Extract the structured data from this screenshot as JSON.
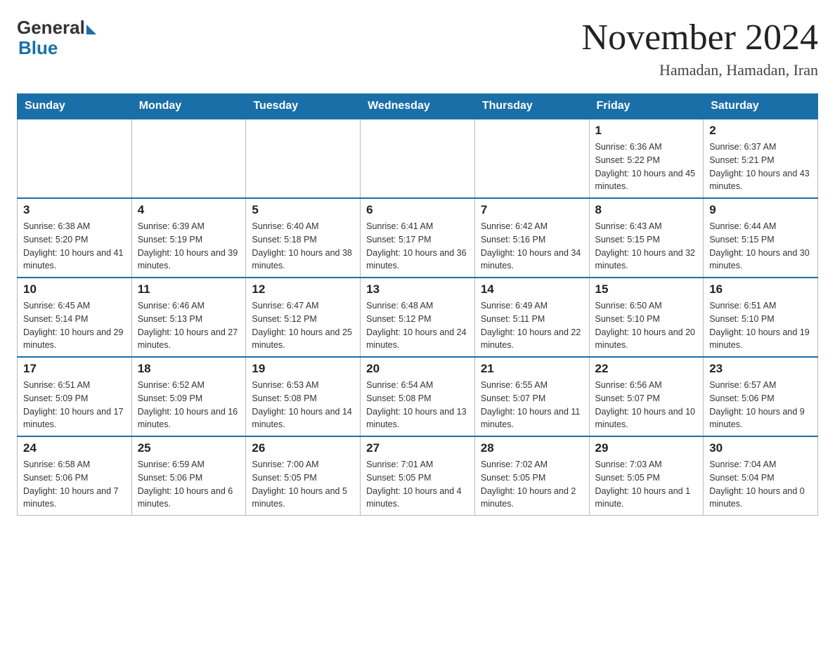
{
  "header": {
    "logo_general": "General",
    "logo_blue": "Blue",
    "month_title": "November 2024",
    "location": "Hamadan, Hamadan, Iran"
  },
  "weekdays": [
    "Sunday",
    "Monday",
    "Tuesday",
    "Wednesday",
    "Thursday",
    "Friday",
    "Saturday"
  ],
  "weeks": [
    [
      {
        "day": "",
        "info": ""
      },
      {
        "day": "",
        "info": ""
      },
      {
        "day": "",
        "info": ""
      },
      {
        "day": "",
        "info": ""
      },
      {
        "day": "",
        "info": ""
      },
      {
        "day": "1",
        "info": "Sunrise: 6:36 AM\nSunset: 5:22 PM\nDaylight: 10 hours and 45 minutes."
      },
      {
        "day": "2",
        "info": "Sunrise: 6:37 AM\nSunset: 5:21 PM\nDaylight: 10 hours and 43 minutes."
      }
    ],
    [
      {
        "day": "3",
        "info": "Sunrise: 6:38 AM\nSunset: 5:20 PM\nDaylight: 10 hours and 41 minutes."
      },
      {
        "day": "4",
        "info": "Sunrise: 6:39 AM\nSunset: 5:19 PM\nDaylight: 10 hours and 39 minutes."
      },
      {
        "day": "5",
        "info": "Sunrise: 6:40 AM\nSunset: 5:18 PM\nDaylight: 10 hours and 38 minutes."
      },
      {
        "day": "6",
        "info": "Sunrise: 6:41 AM\nSunset: 5:17 PM\nDaylight: 10 hours and 36 minutes."
      },
      {
        "day": "7",
        "info": "Sunrise: 6:42 AM\nSunset: 5:16 PM\nDaylight: 10 hours and 34 minutes."
      },
      {
        "day": "8",
        "info": "Sunrise: 6:43 AM\nSunset: 5:15 PM\nDaylight: 10 hours and 32 minutes."
      },
      {
        "day": "9",
        "info": "Sunrise: 6:44 AM\nSunset: 5:15 PM\nDaylight: 10 hours and 30 minutes."
      }
    ],
    [
      {
        "day": "10",
        "info": "Sunrise: 6:45 AM\nSunset: 5:14 PM\nDaylight: 10 hours and 29 minutes."
      },
      {
        "day": "11",
        "info": "Sunrise: 6:46 AM\nSunset: 5:13 PM\nDaylight: 10 hours and 27 minutes."
      },
      {
        "day": "12",
        "info": "Sunrise: 6:47 AM\nSunset: 5:12 PM\nDaylight: 10 hours and 25 minutes."
      },
      {
        "day": "13",
        "info": "Sunrise: 6:48 AM\nSunset: 5:12 PM\nDaylight: 10 hours and 24 minutes."
      },
      {
        "day": "14",
        "info": "Sunrise: 6:49 AM\nSunset: 5:11 PM\nDaylight: 10 hours and 22 minutes."
      },
      {
        "day": "15",
        "info": "Sunrise: 6:50 AM\nSunset: 5:10 PM\nDaylight: 10 hours and 20 minutes."
      },
      {
        "day": "16",
        "info": "Sunrise: 6:51 AM\nSunset: 5:10 PM\nDaylight: 10 hours and 19 minutes."
      }
    ],
    [
      {
        "day": "17",
        "info": "Sunrise: 6:51 AM\nSunset: 5:09 PM\nDaylight: 10 hours and 17 minutes."
      },
      {
        "day": "18",
        "info": "Sunrise: 6:52 AM\nSunset: 5:09 PM\nDaylight: 10 hours and 16 minutes."
      },
      {
        "day": "19",
        "info": "Sunrise: 6:53 AM\nSunset: 5:08 PM\nDaylight: 10 hours and 14 minutes."
      },
      {
        "day": "20",
        "info": "Sunrise: 6:54 AM\nSunset: 5:08 PM\nDaylight: 10 hours and 13 minutes."
      },
      {
        "day": "21",
        "info": "Sunrise: 6:55 AM\nSunset: 5:07 PM\nDaylight: 10 hours and 11 minutes."
      },
      {
        "day": "22",
        "info": "Sunrise: 6:56 AM\nSunset: 5:07 PM\nDaylight: 10 hours and 10 minutes."
      },
      {
        "day": "23",
        "info": "Sunrise: 6:57 AM\nSunset: 5:06 PM\nDaylight: 10 hours and 9 minutes."
      }
    ],
    [
      {
        "day": "24",
        "info": "Sunrise: 6:58 AM\nSunset: 5:06 PM\nDaylight: 10 hours and 7 minutes."
      },
      {
        "day": "25",
        "info": "Sunrise: 6:59 AM\nSunset: 5:06 PM\nDaylight: 10 hours and 6 minutes."
      },
      {
        "day": "26",
        "info": "Sunrise: 7:00 AM\nSunset: 5:05 PM\nDaylight: 10 hours and 5 minutes."
      },
      {
        "day": "27",
        "info": "Sunrise: 7:01 AM\nSunset: 5:05 PM\nDaylight: 10 hours and 4 minutes."
      },
      {
        "day": "28",
        "info": "Sunrise: 7:02 AM\nSunset: 5:05 PM\nDaylight: 10 hours and 2 minutes."
      },
      {
        "day": "29",
        "info": "Sunrise: 7:03 AM\nSunset: 5:05 PM\nDaylight: 10 hours and 1 minute."
      },
      {
        "day": "30",
        "info": "Sunrise: 7:04 AM\nSunset: 5:04 PM\nDaylight: 10 hours and 0 minutes."
      }
    ]
  ]
}
